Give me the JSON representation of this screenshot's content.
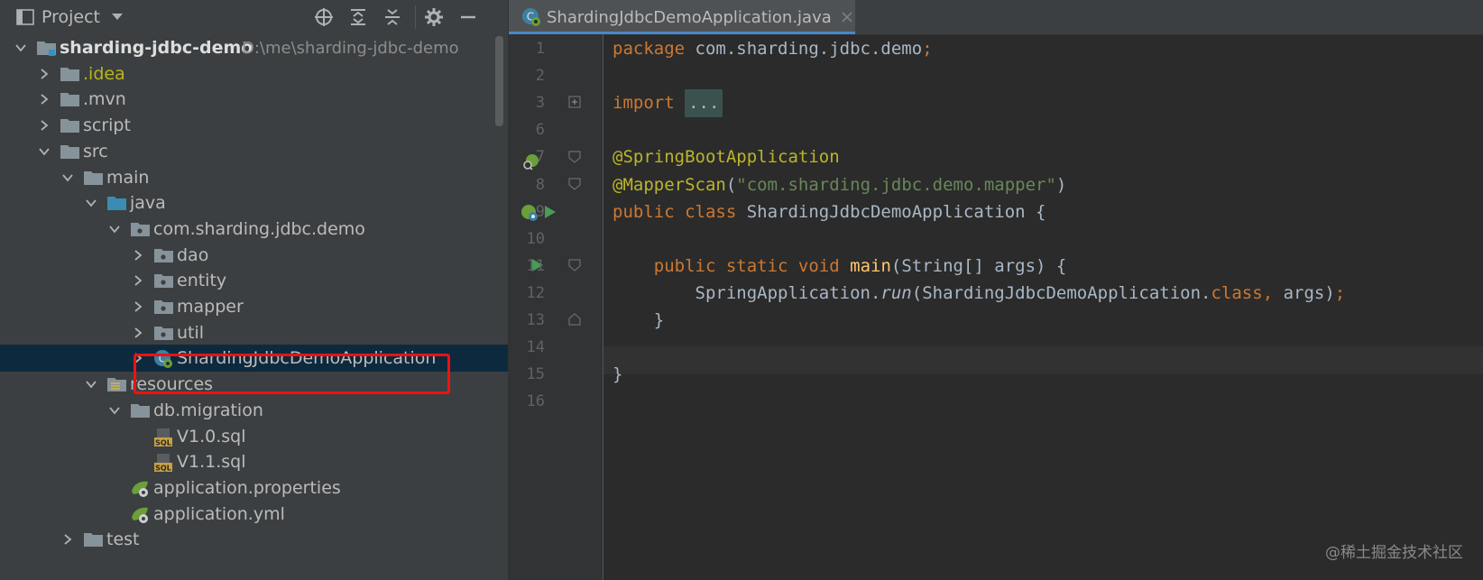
{
  "project_panel": {
    "title": "Project",
    "tree": [
      {
        "label": "sharding-jdbc-demo",
        "path": "D:\\me\\sharding-jdbc-demo",
        "level": 0,
        "expanded": true,
        "icon": "module-folder-icon",
        "bold": true
      },
      {
        "label": ".idea",
        "level": 1,
        "expanded": false,
        "icon": "folder-icon",
        "color": "#b8b51a"
      },
      {
        "label": ".mvn",
        "level": 1,
        "expanded": false,
        "icon": "folder-icon"
      },
      {
        "label": "script",
        "level": 1,
        "expanded": false,
        "icon": "folder-icon"
      },
      {
        "label": "src",
        "level": 1,
        "expanded": true,
        "icon": "folder-icon"
      },
      {
        "label": "main",
        "level": 2,
        "expanded": true,
        "icon": "folder-icon"
      },
      {
        "label": "java",
        "level": 3,
        "expanded": true,
        "icon": "source-folder-icon"
      },
      {
        "label": "com.sharding.jdbc.demo",
        "level": 4,
        "expanded": true,
        "icon": "package-icon"
      },
      {
        "label": "dao",
        "level": 5,
        "expanded": false,
        "icon": "package-icon"
      },
      {
        "label": "entity",
        "level": 5,
        "expanded": false,
        "icon": "package-icon"
      },
      {
        "label": "mapper",
        "level": 5,
        "expanded": false,
        "icon": "package-icon"
      },
      {
        "label": "util",
        "level": 5,
        "expanded": false,
        "icon": "package-icon"
      },
      {
        "label": "ShardingJdbcDemoApplication",
        "level": 5,
        "expanded": false,
        "icon": "spring-boot-class-icon",
        "selected": true
      },
      {
        "label": "resources",
        "level": 3,
        "expanded": true,
        "icon": "resources-folder-icon"
      },
      {
        "label": "db.migration",
        "level": 4,
        "expanded": true,
        "icon": "folder-icon"
      },
      {
        "label": "V1.0.sql",
        "level": 5,
        "leaf": true,
        "icon": "sql-file-icon"
      },
      {
        "label": "V1.1.sql",
        "level": 5,
        "leaf": true,
        "icon": "sql-file-icon"
      },
      {
        "label": "application.properties",
        "level": 4,
        "leaf": true,
        "icon": "spring-config-icon"
      },
      {
        "label": "application.yml",
        "level": 4,
        "leaf": true,
        "icon": "spring-config-icon"
      },
      {
        "label": "test",
        "level": 2,
        "expanded": false,
        "icon": "folder-icon"
      }
    ]
  },
  "editor": {
    "tab_label": "ShardingJdbcDemoApplication.java",
    "current_line": 14,
    "lines": [
      {
        "num": "1",
        "tokens": [
          {
            "t": "package ",
            "c": "kw"
          },
          {
            "t": "com.sharding.jdbc.demo"
          },
          {
            "t": ";",
            "c": "kw"
          }
        ]
      },
      {
        "num": "2",
        "tokens": []
      },
      {
        "num": "3",
        "tokens": [
          {
            "t": "import ",
            "c": "kw"
          },
          {
            "t": "...",
            "c": "fold"
          }
        ]
      },
      {
        "num": "6",
        "tokens": []
      },
      {
        "num": "7",
        "tokens": [
          {
            "t": "@SpringBootApplication",
            "c": "ann"
          }
        ]
      },
      {
        "num": "8",
        "tokens": [
          {
            "t": "@MapperScan",
            "c": "ann"
          },
          {
            "t": "("
          },
          {
            "t": "\"com.sharding.jdbc.demo.mapper\"",
            "c": "str"
          },
          {
            "t": ")"
          }
        ]
      },
      {
        "num": "9",
        "tokens": [
          {
            "t": "public ",
            "c": "kw"
          },
          {
            "t": "class ",
            "c": "kw"
          },
          {
            "t": "ShardingJdbcDemoApplication {"
          }
        ]
      },
      {
        "num": "10",
        "tokens": []
      },
      {
        "num": "11",
        "tokens": [
          {
            "t": "    "
          },
          {
            "t": "public ",
            "c": "kw"
          },
          {
            "t": "static ",
            "c": "kw"
          },
          {
            "t": "void ",
            "c": "kw"
          },
          {
            "t": "main",
            "c": "fn"
          },
          {
            "t": "(String[] args) {"
          }
        ]
      },
      {
        "num": "12",
        "tokens": [
          {
            "t": "        SpringApplication."
          },
          {
            "t": "run",
            "c": "it"
          },
          {
            "t": "(ShardingJdbcDemoApplication."
          },
          {
            "t": "class",
            "c": "kw"
          },
          {
            "t": ", ",
            "c": "kw"
          },
          {
            "t": "args)"
          },
          {
            "t": ";",
            "c": "kw"
          }
        ]
      },
      {
        "num": "13",
        "tokens": [
          {
            "t": "    }"
          }
        ]
      },
      {
        "num": "14",
        "tokens": []
      },
      {
        "num": "15",
        "tokens": [
          {
            "t": "}"
          }
        ]
      },
      {
        "num": "16",
        "tokens": []
      }
    ]
  },
  "watermark": "@稀土掘金技术社区"
}
